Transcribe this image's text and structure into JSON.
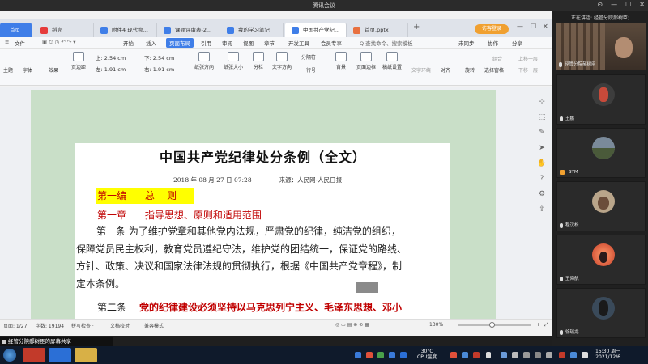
{
  "meeting": {
    "window_title": "腾讯会议",
    "speaker_label": "正在讲话: 经管分院郝树臣;",
    "share_banner": "经管分院郝树臣的屏幕共享"
  },
  "wps": {
    "tabs": [
      {
        "label": "首页"
      },
      {
        "label": "稻壳"
      },
      {
        "label": "附件4 现代物..."
      },
      {
        "label": "课题评审表-2..."
      },
      {
        "label": "我的学习笔记"
      },
      {
        "label": "中国共产党纪..."
      },
      {
        "label": "首页.pptx"
      }
    ],
    "login_button": "访客登录",
    "menu": [
      "文件",
      "开始",
      "插入",
      "页面布局",
      "引用",
      "审阅",
      "视图",
      "章节",
      "开发工具",
      "会员专享"
    ],
    "search_placeholder": "Q 查找命令、搜索模板",
    "menu_right": [
      "未同步",
      "协作",
      "分享"
    ],
    "ribbon": {
      "buttons": [
        "主题",
        "字体",
        "效果",
        "页边距",
        "纸张方向",
        "纸张大小",
        "分栏",
        "文字方向",
        "分隔符",
        "行号",
        "背景",
        "页面边框",
        "稿纸设置",
        "文字环绕",
        "对齐",
        "旋转",
        "选择窗格",
        "上移一层",
        "下移一层",
        "组合"
      ],
      "margin_top": "上: 2.54 cm",
      "margin_bottom": "下: 2.54 cm",
      "margin_left": "左: 1.91 cm",
      "margin_right": "右: 1.91 cm"
    }
  },
  "document": {
    "title": "中国共产党纪律处分条例（全文）",
    "date": "2018 年 08 月 27 日 07:28",
    "source": "来源：人民网-人民日报",
    "part1": "第一编      总    则",
    "chapter1": "第一章      指导思想、原则和适用范围",
    "article1_lines": [
      "第一条    为了维护党章和其他党内法规，严肃党的纪律，纯洁党的组织，",
      "保障党员民主权利，教育党员遵纪守法，维护党的团结统一，保证党的路线、",
      "方针、政策、决议和国家法律法规的贯彻执行，根据《中国共产党章程》，制",
      "定本条例。"
    ],
    "article2_no": "第二条",
    "article2_text": "党的纪律建设必须坚持以马克思列宁主义、毛泽东思想、邓小"
  },
  "status": {
    "page": "页面: 1/27",
    "words": "字数: 19194",
    "spell": "拼写检查 ·",
    "proof": "文档校对",
    "compat": "兼容模式",
    "zoom": "130% ·",
    "zoom_fraction": 0.45
  },
  "participants": [
    {
      "name": "经管分院郝树臣"
    },
    {
      "name": "王鹏"
    },
    {
      "name": "SYM"
    },
    {
      "name": "程汉松"
    },
    {
      "name": "王海航"
    },
    {
      "name": "徐瑞龙"
    }
  ],
  "taskbar": {
    "temp": "30°C",
    "cpu": "CPU温度",
    "time": "15:30 周一",
    "date": "2021/12/6"
  },
  "colors": {
    "wps_blue": "#3f7ee8",
    "highlight": "#ffff00",
    "heading_red": "#c00000",
    "page_green": "#c9dfc8"
  }
}
